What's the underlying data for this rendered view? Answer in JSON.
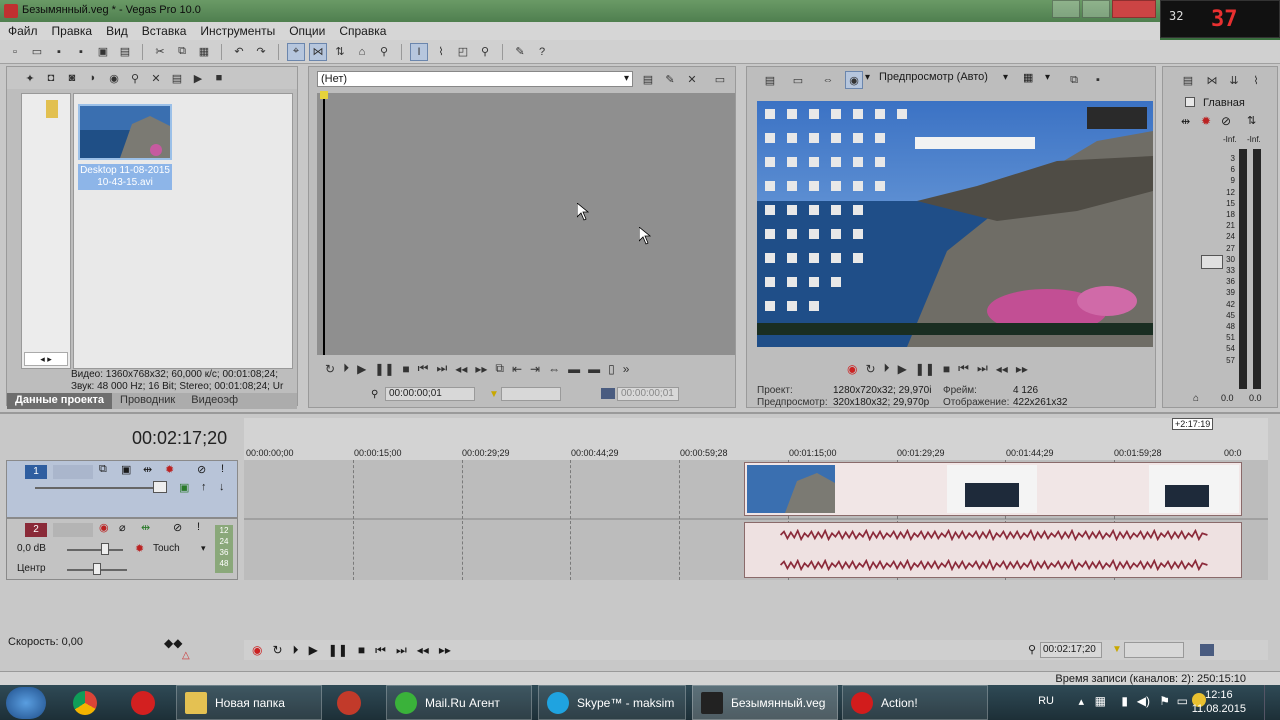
{
  "window": {
    "title": "Безымянный.veg * - Vegas Pro 10.0"
  },
  "recorder_overlay": {
    "small": "32",
    "big": "37"
  },
  "menu": [
    "Файл",
    "Правка",
    "Вид",
    "Вставка",
    "Инструменты",
    "Опции",
    "Справка"
  ],
  "project_media": {
    "clip_name": "Desktop 11-08-2015 10-43-15.avi",
    "info_video": "Видео: 1360x768x32; 60,000 к/с; 00:01:08;24; ",
    "info_audio": "Звук: 48 000 Hz; 16 Bit; Stereo; 00:01:08;24; Ur",
    "tabs": [
      "Данные проекта",
      "Проводник",
      "Видеоэф"
    ]
  },
  "trimmer": {
    "selector_value": "(Нет)",
    "time1": "00:00:00;01",
    "time2": "00:00:00;01"
  },
  "preview": {
    "quality_label": "Предпросмотр (Авто)",
    "stats": {
      "project_label": "Проект:",
      "project_value": "1280x720x32; 29,970i",
      "frame_label": "Фрейм:",
      "frame_value": "4 126",
      "preview_label": "Предпросмотр:",
      "preview_value": "320x180x32; 29,970p",
      "display_label": "Отображение:",
      "display_value": "422x261x32"
    }
  },
  "mixer": {
    "title": "Главная",
    "inf_left": "-Inf.",
    "inf_right": "-Inf.",
    "scale": [
      "3",
      "6",
      "9",
      "12",
      "15",
      "18",
      "21",
      "24",
      "27",
      "30",
      "33",
      "36",
      "39",
      "42",
      "45",
      "48",
      "51",
      "54",
      "57"
    ],
    "val_left": "0.0",
    "val_right": "0.0"
  },
  "timeline": {
    "current_time": "00:02:17;20",
    "end_marker": "+2:17:19",
    "ruler_labels": [
      "00:00:00;00",
      "00:00:15;00",
      "00:00:29;29",
      "00:00:44;29",
      "00:00:59;28",
      "00:01:15;00",
      "00:01:29;29",
      "00:01:44;29",
      "00:01:59;28",
      "00:0"
    ],
    "video_track": {
      "number": "1"
    },
    "audio_track": {
      "number": "2",
      "volume": "0,0 dB",
      "automation": "Touch",
      "pan": "Центр",
      "meter_labels": [
        "12",
        "24",
        "36",
        "48"
      ]
    },
    "speed": "Скорость: 0,00",
    "bottom_time": "00:02:17;20",
    "status": "Время записи (каналов: 2): 250:15:10"
  },
  "taskbar": {
    "buttons": [
      "Новая папка",
      "Mail.Ru Агент",
      "Skype™ - maksim",
      "Безымянный.veg",
      "Action!"
    ],
    "lang": "RU",
    "time": "12:16",
    "date": "11.08.2015"
  },
  "colors": {
    "vegas_bg": "#c8c8c8",
    "track_video": "#b8c4d8",
    "audio_wave": "#8b2a3a",
    "taskbar": "#1d2f37"
  }
}
